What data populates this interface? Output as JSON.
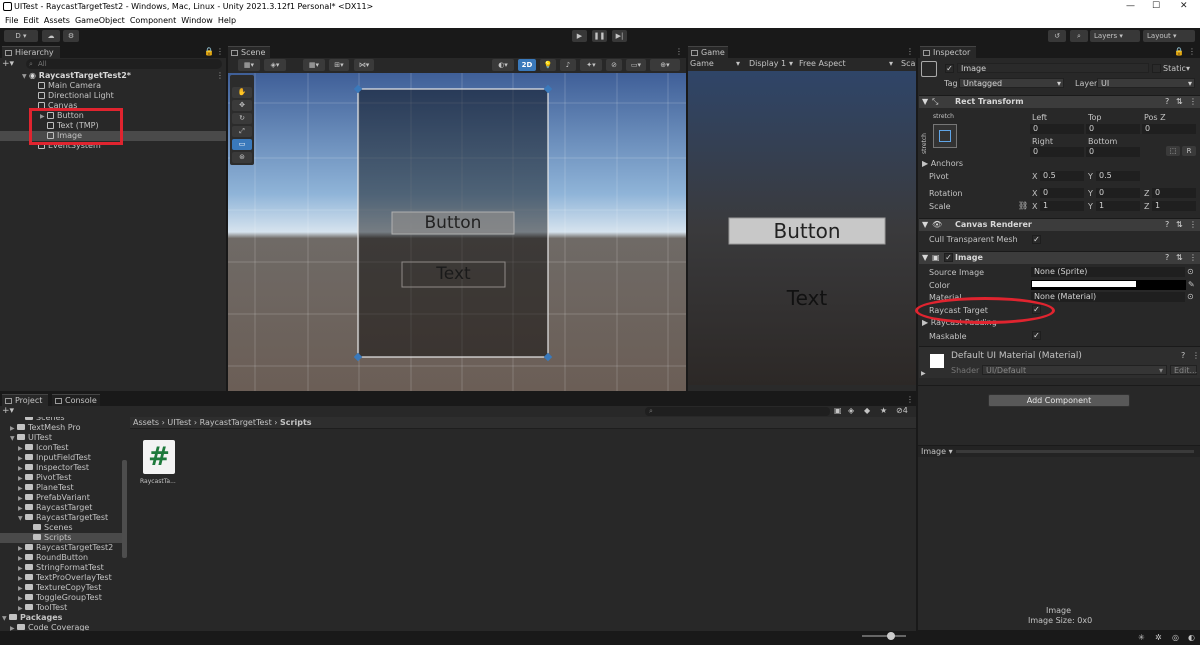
{
  "window": {
    "title": "UITest - RaycastTargetTest2 - Windows, Mac, Linux - Unity 2021.3.12f1 Personal* <DX11>",
    "minimize": "—",
    "maximize": "☐",
    "close": "✕"
  },
  "menu": [
    "File",
    "Edit",
    "Assets",
    "GameObject",
    "Component",
    "Window",
    "Help"
  ],
  "toolbar": {
    "account": "D",
    "layers": "Layers",
    "layout": "Layout"
  },
  "hierarchy": {
    "tab": "Hierarchy",
    "search_placeholder": "All",
    "scene": "RaycastTargetTest2*",
    "items": [
      "Main Camera",
      "Directional Light",
      "Canvas",
      "Button",
      "Text (TMP)",
      "Image",
      "EventSystem"
    ]
  },
  "scene": {
    "tab": "Scene",
    "mode_2d": "2D",
    "button_label": "Button",
    "text_label": "Text"
  },
  "game": {
    "tab": "Game",
    "mode": "Game",
    "display": "Display 1",
    "aspect": "Free Aspect",
    "scale": "Sca",
    "button_label": "Button",
    "text_label": "Text"
  },
  "inspector": {
    "tab": "Inspector",
    "object_name": "Image",
    "static_label": "Static",
    "tag_label": "Tag",
    "tag_value": "Untagged",
    "layer_label": "Layer",
    "layer_value": "UI",
    "rect_transform": {
      "title": "Rect Transform",
      "anchor_preset": "stretch",
      "anchor_side": "stretch",
      "left_label": "Left",
      "left": "0",
      "top_label": "Top",
      "top": "0",
      "posz_label": "Pos Z",
      "posz": "0",
      "right_label": "Right",
      "right": "0",
      "bottom_label": "Bottom",
      "bottom": "0",
      "anchors_label": "Anchors",
      "pivot_label": "Pivot",
      "pivot_x": "0.5",
      "pivot_y": "0.5",
      "rotation_label": "Rotation",
      "rot_x": "0",
      "rot_y": "0",
      "rot_z": "0",
      "scale_label": "Scale",
      "scale_x": "1",
      "scale_y": "1",
      "scale_z": "1",
      "x": "X",
      "y": "Y",
      "z": "Z",
      "blueprint": "R"
    },
    "canvas_renderer": {
      "title": "Canvas Renderer",
      "cull_label": "Cull Transparent Mesh"
    },
    "image": {
      "title": "Image",
      "source_label": "Source Image",
      "source_value": "None (Sprite)",
      "color_label": "Color",
      "material_label": "Material",
      "material_value": "None (Material)",
      "raycast_target_label": "Raycast Target",
      "raycast_padding_label": "Raycast Padding",
      "maskable_label": "Maskable"
    },
    "material": {
      "name": "Default UI Material (Material)",
      "shader_label": "Shader",
      "shader_value": "UI/Default",
      "edit_label": "Edit..."
    },
    "add_component": "Add Component",
    "preview_label": "Image ▾",
    "preview_name": "Image",
    "preview_size": "Image Size: 0x0"
  },
  "project": {
    "tab_project": "Project",
    "tab_console": "Console",
    "breadcrumb": [
      "Assets",
      "UITest",
      "RaycastTargetTest",
      "Scripts"
    ],
    "hidden_count": "4",
    "tree": [
      {
        "label": "Scenes",
        "indent": 2,
        "arrow": false
      },
      {
        "label": "TextMesh Pro",
        "indent": 1,
        "arrow": true
      },
      {
        "label": "UITest",
        "indent": 1,
        "arrow": true,
        "open": true
      },
      {
        "label": "IconTest",
        "indent": 2,
        "arrow": true
      },
      {
        "label": "InputFieldTest",
        "indent": 2,
        "arrow": true
      },
      {
        "label": "InspectorTest",
        "indent": 2,
        "arrow": true
      },
      {
        "label": "PivotTest",
        "indent": 2,
        "arrow": true
      },
      {
        "label": "PlaneTest",
        "indent": 2,
        "arrow": true
      },
      {
        "label": "PrefabVariant",
        "indent": 2,
        "arrow": true
      },
      {
        "label": "RaycastTarget",
        "indent": 2,
        "arrow": true
      },
      {
        "label": "RaycastTargetTest",
        "indent": 2,
        "arrow": true,
        "open": true
      },
      {
        "label": "Scenes",
        "indent": 3,
        "arrow": false
      },
      {
        "label": "Scripts",
        "indent": 3,
        "arrow": false,
        "selected": true
      },
      {
        "label": "RaycastTargetTest2",
        "indent": 2,
        "arrow": true
      },
      {
        "label": "RoundButton",
        "indent": 2,
        "arrow": true
      },
      {
        "label": "StringFormatTest",
        "indent": 2,
        "arrow": true
      },
      {
        "label": "TextProOverlayTest",
        "indent": 2,
        "arrow": true
      },
      {
        "label": "TextureCopyTest",
        "indent": 2,
        "arrow": true
      },
      {
        "label": "ToggleGroupTest",
        "indent": 2,
        "arrow": true
      },
      {
        "label": "ToolTest",
        "indent": 2,
        "arrow": true
      }
    ],
    "packages_label": "Packages",
    "code_coverage": "Code Coverage",
    "asset_name": "RaycastTa...",
    "asset_glyph": "#"
  },
  "colors": {
    "accent": "#3a79bb",
    "annotation": "#e0242f",
    "script_icon": "#1e7a3c"
  }
}
